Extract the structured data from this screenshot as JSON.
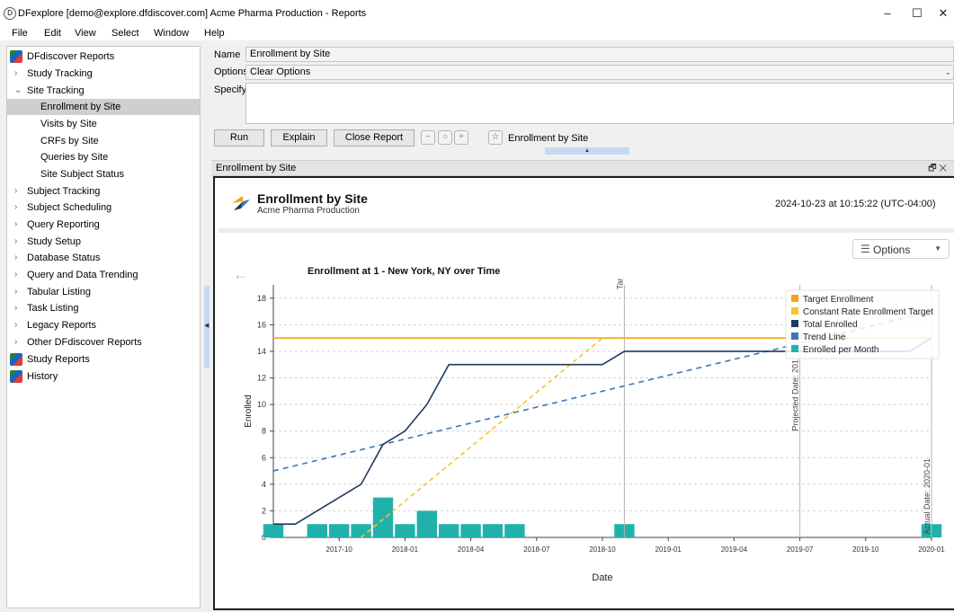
{
  "window": {
    "title": "DFexplore [demo@explore.dfdiscover.com] Acme Pharma Production - Reports"
  },
  "menu": [
    "File",
    "Edit",
    "View",
    "Select",
    "Window",
    "Help"
  ],
  "sidebar": {
    "root": "DFdiscover Reports",
    "items": [
      {
        "label": "Study Tracking"
      },
      {
        "label": "Site Tracking"
      },
      {
        "label": "Enrollment by Site"
      },
      {
        "label": "Visits by Site"
      },
      {
        "label": "CRFs by Site"
      },
      {
        "label": "Queries by Site"
      },
      {
        "label": "Site Subject Status"
      },
      {
        "label": "Subject Tracking"
      },
      {
        "label": "Subject Scheduling"
      },
      {
        "label": "Query Reporting"
      },
      {
        "label": "Study Setup"
      },
      {
        "label": "Database Status"
      },
      {
        "label": "Query and Data Trending"
      },
      {
        "label": "Tabular Listing"
      },
      {
        "label": "Task Listing"
      },
      {
        "label": "Legacy Reports"
      },
      {
        "label": "Other DFdiscover Reports"
      },
      {
        "label": "Study Reports"
      },
      {
        "label": "History"
      }
    ]
  },
  "form": {
    "name_label": "Name",
    "name_value": "Enrollment by Site",
    "options_label": "Options",
    "options_value": "Clear Options",
    "specify_label": "Specify"
  },
  "toolbar": {
    "run": "Run",
    "explain": "Explain",
    "close": "Close Report",
    "favorite_label": "Enrollment by Site"
  },
  "panel": {
    "title": "Enrollment by Site"
  },
  "report": {
    "title": "Enrollment by Site",
    "subtitle": "Acme Pharma Production",
    "timestamp": "2024-10-23 at 10:15:22 (UTC-04:00)",
    "options_label": "Options"
  },
  "chart_data": {
    "type": "line",
    "title": "Enrollment at 1 - New York, NY over Time",
    "xlabel": "Date",
    "ylabel": "Enrolled",
    "ylim": [
      0,
      19
    ],
    "x_ticks": [
      "2017-10",
      "2018-01",
      "2018-04",
      "2018-07",
      "2018-10",
      "2019-01",
      "2019-04",
      "2019-07",
      "2019-10",
      "2020-01"
    ],
    "y_ticks": [
      0,
      2,
      4,
      6,
      8,
      10,
      12,
      14,
      16,
      18
    ],
    "grid": true,
    "legend": "top-right",
    "colors": {
      "target": "#f2a31b",
      "constant": "#f6c42a",
      "total": "#1e3a5f",
      "trend": "#3a78b5",
      "monthly": "#20b2aa"
    },
    "series": [
      {
        "name": "Target Enrollment",
        "x": [
          "2017-07",
          "2020-01"
        ],
        "y": [
          15,
          15
        ]
      },
      {
        "name": "Constant Rate Enrollment Target",
        "x": [
          "2017-11",
          "2018-10"
        ],
        "y": [
          0,
          15
        ]
      },
      {
        "name": "Total Enrolled",
        "x": [
          "2017-07",
          "2017-08",
          "2017-11",
          "2017-12",
          "2018-01",
          "2018-02",
          "2018-03",
          "2018-06",
          "2018-10",
          "2018-11",
          "2019-12",
          "2020-01"
        ],
        "y": [
          1,
          1,
          4,
          7,
          8,
          10,
          13,
          13,
          13,
          14,
          14,
          15
        ]
      },
      {
        "name": "Trend Line",
        "x": [
          "2017-07",
          "2020-01"
        ],
        "y": [
          5,
          17
        ]
      },
      {
        "name": "Enrolled per Month",
        "x": [
          "2017-07",
          "2017-09",
          "2017-10",
          "2017-11",
          "2017-12",
          "2018-01",
          "2018-02",
          "2018-03",
          "2018-04",
          "2018-05",
          "2018-06",
          "2018-11",
          "2020-01"
        ],
        "y": [
          1,
          1,
          1,
          1,
          3,
          1,
          2,
          1,
          1,
          1,
          1,
          1,
          1
        ]
      }
    ],
    "annotations": [
      "Target Dat",
      "Projected Date: 201",
      "Actual Date: 2020-01"
    ]
  }
}
